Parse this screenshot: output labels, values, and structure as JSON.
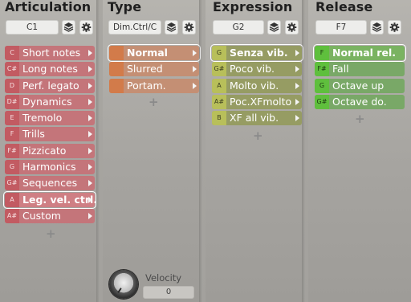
{
  "colors": {
    "articulation": "#c4757a",
    "type": "#c48f74",
    "expression": "#969c63",
    "release": "#79a867",
    "selected_outline": "#ffffff"
  },
  "icons": {
    "stack": "layers-icon",
    "settings": "gear-icon",
    "arrow": "triangle-right-icon",
    "knob": "knob-icon"
  },
  "articulation": {
    "title": "Articulation",
    "key": "C1",
    "plus": "+",
    "items": [
      {
        "key": "C",
        "label": "Short notes"
      },
      {
        "key": "C#",
        "label": "Long notes"
      },
      {
        "key": "D",
        "label": "Perf. legato"
      },
      {
        "key": "D#",
        "label": "Dynamics"
      },
      {
        "key": "E",
        "label": "Tremolo"
      },
      {
        "key": "F",
        "label": "Trills"
      },
      {
        "key": "F#",
        "label": "Pizzicato"
      },
      {
        "key": "G",
        "label": "Harmonics"
      },
      {
        "key": "G#",
        "label": "Sequences"
      },
      {
        "key": "A",
        "label": "Leg. vel. ctrl.",
        "selected": true
      },
      {
        "key": "A#",
        "label": "Custom"
      }
    ]
  },
  "type": {
    "title": "Type",
    "key": "Dim.Ctrl/C",
    "plus": "+",
    "items": [
      {
        "key": "",
        "label": "Normal",
        "selected": true
      },
      {
        "key": "",
        "label": "Slurred"
      },
      {
        "key": "",
        "label": "Portam."
      }
    ],
    "velocity_label": "Velocity",
    "velocity_value": "0"
  },
  "expression": {
    "title": "Expression",
    "key": "G2",
    "plus": "+",
    "items": [
      {
        "key": "G",
        "label": "Senza vib.",
        "selected": true
      },
      {
        "key": "G#",
        "label": "Poco vib."
      },
      {
        "key": "A",
        "label": "Molto vib."
      },
      {
        "key": "A#",
        "label": "Poc.XFmolto"
      },
      {
        "key": "B",
        "label": "XF all vib."
      }
    ]
  },
  "release": {
    "title": "Release",
    "key": "F7",
    "plus": "+",
    "items": [
      {
        "key": "F",
        "label": "Normal rel.",
        "selected": true
      },
      {
        "key": "F#",
        "label": "Fall"
      },
      {
        "key": "G",
        "label": "Octave up"
      },
      {
        "key": "G#",
        "label": "Octave do."
      }
    ]
  }
}
